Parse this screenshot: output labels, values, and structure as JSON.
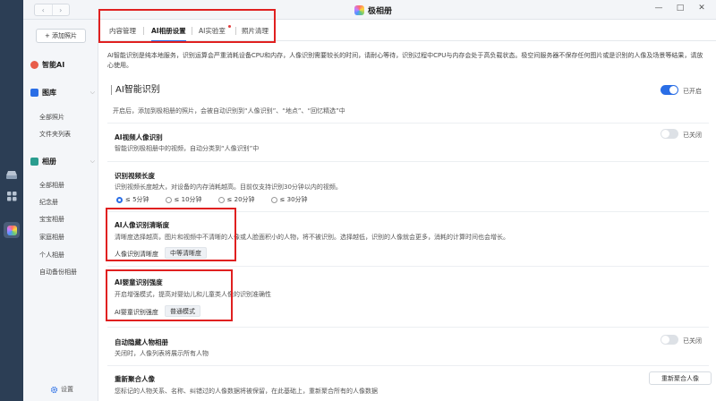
{
  "window": {
    "title": "极相册"
  },
  "sidebar": {
    "add_button": "+ 添加照片",
    "sections": [
      {
        "label": "智能AI",
        "color": "#e85d4a"
      },
      {
        "label": "图库",
        "color": "#2a6ee6"
      },
      {
        "label": "相册",
        "color": "#2a9d8f"
      }
    ],
    "library_items": [
      "全部照片",
      "文件夹列表"
    ],
    "album_items": [
      "全部相册",
      "纪念册",
      "宝宝相册",
      "家庭相册",
      "个人相册",
      "自动备份相册"
    ],
    "settings_label": "设置"
  },
  "tabs": [
    "内容管理",
    "AI相册设置",
    "AI实验室",
    "照片清理"
  ],
  "active_tab": 1,
  "intro_text": "AI智能识别是纯本地服务，识别运算会严重消耗设备CPU和内存，人像识别需要较长的时间，请耐心等待，识别过程中CPU与内存会处于高负载状态。极空间服务器不保存任何图片或是识别的人像及场景等结果，请放心使用。",
  "ai_section": {
    "title": "AI智能识别",
    "toggle_label": "已开启",
    "description": "开启后，添加到极相册的照片，会被自动识别到“人像识别”、“地点”、“回忆精选”中"
  },
  "video_face": {
    "title": "AI视频人像识别",
    "description": "智能识别极相册中的视频，自动分类到“人像识别”中",
    "toggle_label": "已关闭"
  },
  "video_length": {
    "title": "识别视频长度",
    "description": "识别视频长度越大，对设备的内存消耗越高。目前仅支持识别30分钟以内的视频。",
    "options": [
      "≤ 5分钟",
      "≤ 10分钟",
      "≤ 20分钟",
      "≤ 30分钟"
    ],
    "selected": 0
  },
  "face_clarity": {
    "title": "AI人像识别清晰度",
    "description": "清晰度选择越高，图片和视频中不清晰的人像或人脸面积小的人物，将不被识别。选择越低，识别的人像就会更多，消耗的计算时间也会增长。",
    "setting_label": "人像识别清晰度",
    "setting_value": "中等清晰度"
  },
  "baby_strength": {
    "title": "AI婴童识别强度",
    "description": "开启增强模式，提高对婴幼儿和儿童类人像的识别准确性",
    "setting_label": "AI婴童识别强度",
    "setting_value": "普通模式"
  },
  "auto_hide": {
    "title": "自动隐藏人物相册",
    "description": "关闭时，人像列表将展示所有人物",
    "toggle_label": "已关闭"
  },
  "regroup": {
    "title": "重新聚合人像",
    "description": "您标记的人物关系、名称、纠错过的人像数据将被保留，在此基础上，重新聚合所有的人像数据",
    "button_label": "重新聚合人像"
  }
}
